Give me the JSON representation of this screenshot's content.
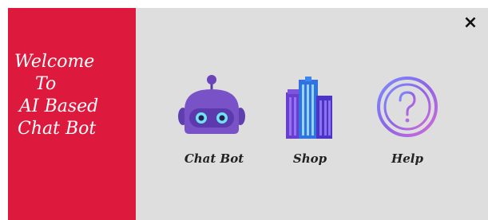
{
  "welcome": {
    "line1": "Welcome",
    "line2": "To",
    "line3": "AI Based",
    "line4": "Chat Bot"
  },
  "close": {
    "label": "×"
  },
  "menu": {
    "items": [
      {
        "label": "Chat Bot",
        "icon": "robot-icon"
      },
      {
        "label": "Shop",
        "icon": "buildings-icon"
      },
      {
        "label": "Help",
        "icon": "question-circle-icon"
      }
    ]
  },
  "colors": {
    "panel": "#dd1a3d",
    "background": "#dedede",
    "robot": "#7a52c7",
    "buildings": "#5b4bd6",
    "help_ring": "#8e63e6"
  }
}
